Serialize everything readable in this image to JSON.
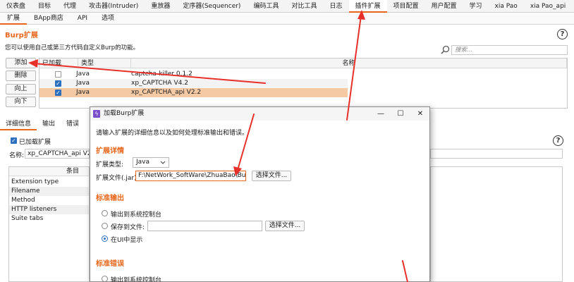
{
  "top_tabs": [
    "仪表盘",
    "目标",
    "代理",
    "攻击器(Intruder)",
    "重放器",
    "定序器(Sequencer)",
    "编码工具",
    "对比工具",
    "日志",
    "插件扩展",
    "项目配置",
    "用户配置",
    "学习",
    "xia Pao",
    "xia Pao_api"
  ],
  "sub_tabs": [
    "扩展",
    "BApp商店",
    "API",
    "选项"
  ],
  "burp_ext": {
    "title": "Burp扩展",
    "desc": "您可以使用自己或第三方代码自定义Burp的功能。",
    "search_placeholder": "搜索...",
    "buttons": {
      "add": "添加",
      "remove": "删除",
      "up": "向上",
      "down": "向下"
    },
    "columns": {
      "loaded": "已加载",
      "type": "类型",
      "name": "名称"
    },
    "rows": [
      {
        "type": "Java",
        "name": "captcha-killer 0.1.2",
        "loaded": false
      },
      {
        "type": "Java",
        "name": "xp_CAPTCHA V4.2",
        "loaded": true
      },
      {
        "type": "Java",
        "name": "xp_CAPTCHA_api V2.2",
        "loaded": true
      }
    ]
  },
  "lower": {
    "tabs": [
      "详细信息",
      "输出",
      "错误"
    ],
    "loaded_label": "已加载扩展",
    "name_label": "名称:",
    "name_value": "xp_CAPTCHA_api V2.2",
    "item_header": "条目",
    "items": [
      "Extension type",
      "Filename",
      "Method",
      "HTTP listeners",
      "Suite tabs"
    ]
  },
  "dialog": {
    "title": "加载Burp扩展",
    "intro": "请输入扩展的详细信息以及如何处理标准输出和错误。",
    "details_title": "扩展详情",
    "type_label": "扩展类型:",
    "type_value": "Java",
    "file_label": "扩展文件(.jar)",
    "file_value": "F:\\NetWork_SoftWare\\ZhuaBao\\Burp_2",
    "choose_file": "选择文件...",
    "stdout_title": "标准输出",
    "stdout_opt1": "输出到系统控制台",
    "stdout_opt2": "保存到文件:",
    "stdout_opt3": "在UI中显示",
    "stderr_title": "标准错误",
    "stderr_opt1": "输出到系统控制台"
  },
  "colors": {
    "accent": "#e8671c",
    "arrow": "#e8302a",
    "selected_row": "#f6c9a5",
    "check_blue": "#2c6fbf"
  },
  "icons": {
    "help": "help-icon",
    "search": "search-icon",
    "dialog": "burp-extension-icon"
  },
  "glyphs": {
    "help": "?",
    "check": "✓",
    "minimize": "—",
    "maximize": "☐",
    "close": "✕",
    "dialog_icon": "ϟ"
  }
}
